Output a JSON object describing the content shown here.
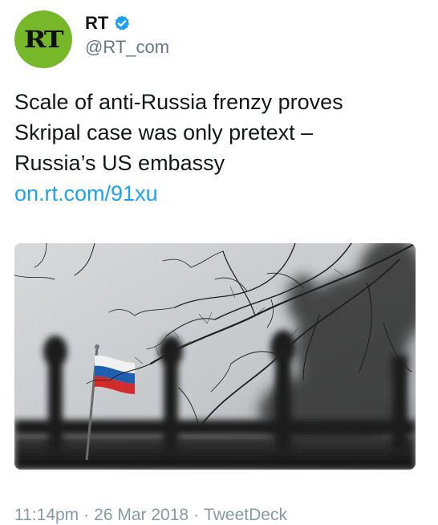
{
  "account": {
    "avatar_text": "RT",
    "display_name": "RT",
    "handle": "@RT_com",
    "verified_icon": "verified-badge-icon",
    "colors": {
      "avatar_bg": "#77b82a",
      "verified": "#1da1f2",
      "link": "#1da1f2"
    }
  },
  "tweet": {
    "text_lines": [
      "Scale of anti-Russia frenzy proves",
      "Skripal case was only pretext –",
      "Russia’s US embassy"
    ],
    "link": "on.rt.com/91xu"
  },
  "media": {
    "image": "russian-flag-behind-fence-and-bare-branches"
  },
  "meta": {
    "time": "11:14pm",
    "date": "26 Mar 2018",
    "source": "TweetDeck",
    "separator": "·"
  }
}
